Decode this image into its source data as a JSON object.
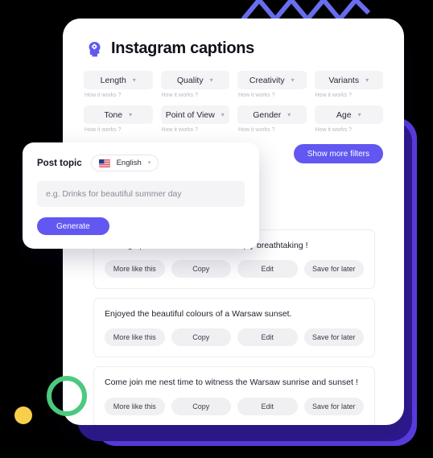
{
  "app": {
    "title": "Instagram captions",
    "brand_icon": "brain-head-icon"
  },
  "filters": {
    "hint_label": "How it works ?",
    "chevron_icon": "chevron-down-icon",
    "items": [
      {
        "label": "Length",
        "hint": "How it works ?"
      },
      {
        "label": "Quality",
        "hint": "How it works ?"
      },
      {
        "label": "Creativity",
        "hint": "How it works ?"
      },
      {
        "label": "Variants",
        "hint": "How it works ?"
      },
      {
        "label": "Tone",
        "hint": "How it works ?"
      },
      {
        "label": "Point of View",
        "hint": "How it works ?"
      },
      {
        "label": "Gender",
        "hint": "How it works ?"
      },
      {
        "label": "Age",
        "hint": "How it works ?"
      }
    ],
    "show_more_label": "Show more filters"
  },
  "topic_panel": {
    "label": "Post topic",
    "language": "English",
    "flag_icon": "us-flag-icon",
    "chevron_icon": "chevron-down-icon",
    "input_value": "",
    "input_placeholder": "e.g. Drinks for beautiful summer day",
    "generate_label": "Generate"
  },
  "results": {
    "actions": [
      "More like this",
      "Copy",
      "Edit",
      "Save for later"
    ],
    "items": [
      {
        "text": "Waking up to a Warsaw sunrise - simply breathtaking !"
      },
      {
        "text": "Enjoyed the beautiful colours of a Warsaw sunset."
      },
      {
        "text": "Come join me nest time to witness the Warsaw sunrise and sunset !"
      }
    ]
  },
  "decor": {
    "zigzag_color": "#6a6ef0",
    "slab_dark_color": "#2e1a8f",
    "slab_violet_color": "#5b3de0",
    "ring_color": "#4cc97f",
    "dot_color": "#f7cf4a",
    "accent_color": "#6257f0"
  }
}
